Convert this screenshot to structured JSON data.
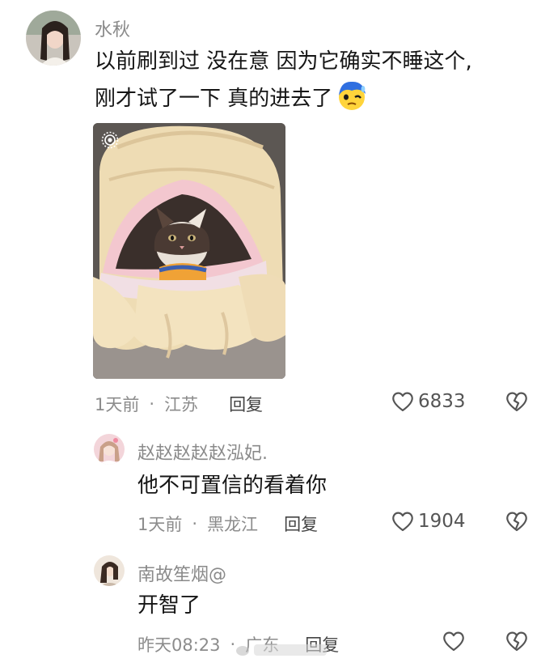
{
  "comments": [
    {
      "username": "水秋",
      "line1": "以前刷到过 没在意 因为它确实不睡这个,",
      "line2": "刚才试了一下 真的进去了",
      "emoji": "flustered-face-emoji",
      "time": "1天前",
      "location": "江苏",
      "reply_label": "回复",
      "likes": "6833"
    },
    {
      "username": "赵赵赵赵赵泓妃.",
      "text": "他不可置信的看着你",
      "time": "1天前",
      "location": "黑龙江",
      "reply_label": "回复",
      "likes": "1904"
    },
    {
      "username": "南故笙烟@",
      "text": "开智了",
      "time": "昨天08:23",
      "location": "广东",
      "reply_label": "回复",
      "likes": ""
    }
  ],
  "icons": {
    "like": "heart-outline-icon",
    "dislike": "broken-heart-icon",
    "live_photo": "live-photo-icon"
  }
}
